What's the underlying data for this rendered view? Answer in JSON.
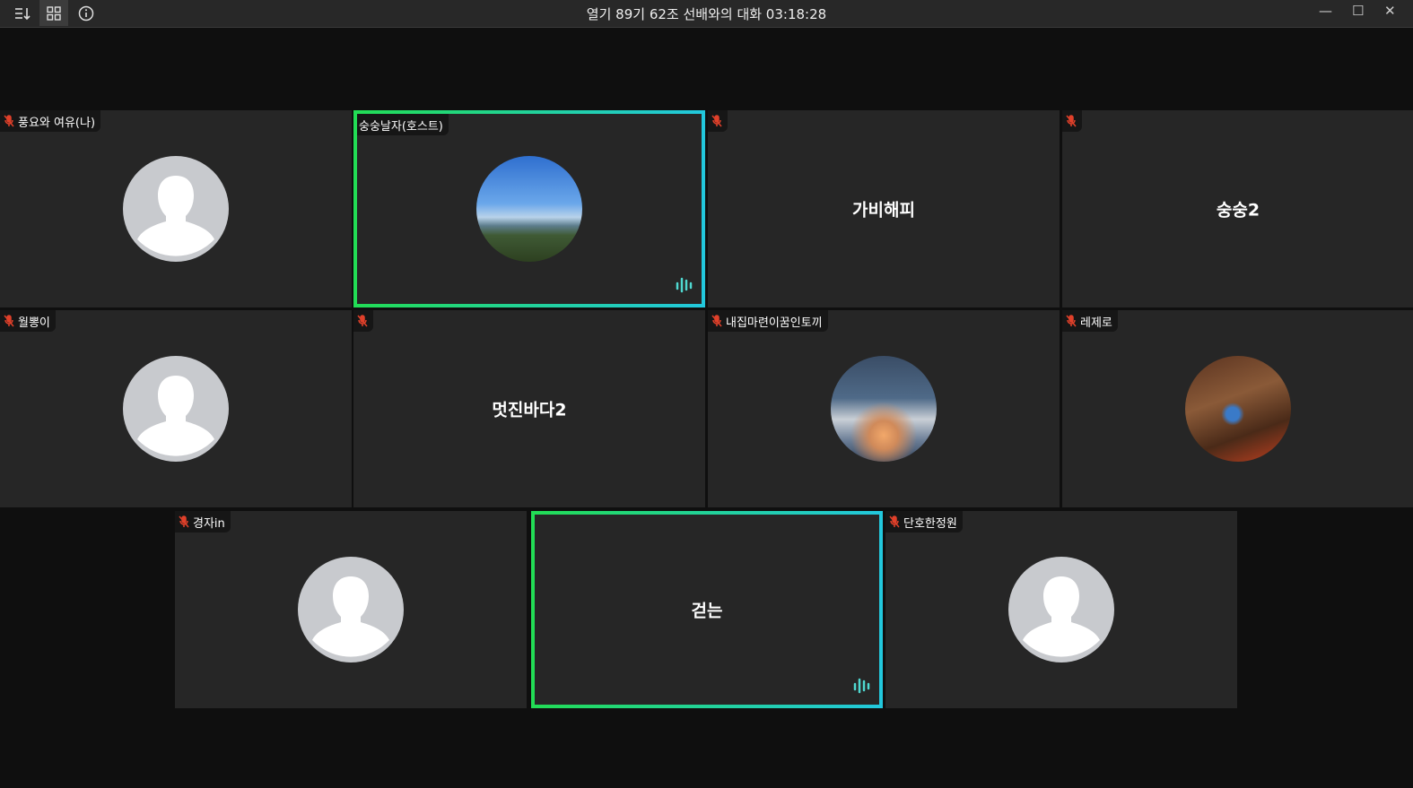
{
  "title": "열기 89기 62조 선배와의 대화 03:18:28",
  "toolbar": {
    "icons": [
      "sort-icon",
      "grid-view-icon",
      "info-icon"
    ]
  },
  "participants": [
    {
      "name": "풍요와 여유(나)",
      "display": "",
      "avatar": "default",
      "muted": true,
      "speaking": false
    },
    {
      "name": "숭숭날자(호스트)",
      "display": "",
      "avatar": "sky-photo",
      "muted": false,
      "speaking": true
    },
    {
      "name": "",
      "display": "가비해피",
      "avatar": "none",
      "muted": true,
      "speaking": false
    },
    {
      "name": "",
      "display": "숭숭2",
      "avatar": "none",
      "muted": true,
      "speaking": false
    },
    {
      "name": "월뽕이",
      "display": "",
      "avatar": "default",
      "muted": true,
      "speaking": false
    },
    {
      "name": "",
      "display": "멋진바다2",
      "avatar": "none",
      "muted": true,
      "speaking": false
    },
    {
      "name": "내집마련이꿈인토끼",
      "display": "",
      "avatar": "clouds-photo",
      "muted": true,
      "speaking": false
    },
    {
      "name": "레제로",
      "display": "",
      "avatar": "room-photo",
      "muted": true,
      "speaking": false
    },
    {
      "name": "경자in",
      "display": "",
      "avatar": "default",
      "muted": true,
      "speaking": false
    },
    {
      "name": "",
      "display": "걷는",
      "avatar": "none",
      "muted": false,
      "speaking": true
    },
    {
      "name": "단호한정원",
      "display": "",
      "avatar": "default",
      "muted": true,
      "speaking": false
    }
  ],
  "colors": {
    "muted": "#e0402a",
    "speaking_from": "#22dd55",
    "speaking_to": "#22c8dd"
  }
}
